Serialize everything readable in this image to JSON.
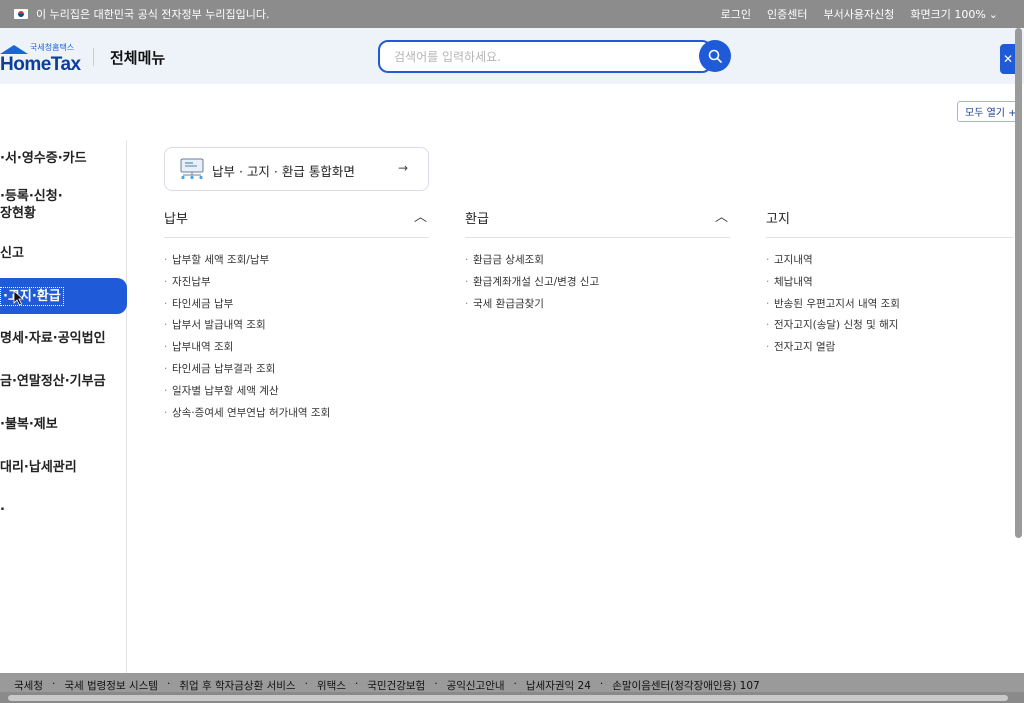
{
  "govbar": {
    "notice": "이 누리집은 대한민국 공식 전자정부 누리집입니다.",
    "links": [
      {
        "label": "로그인"
      },
      {
        "label": "인증센터"
      },
      {
        "label": "부서사용자신청"
      },
      {
        "label": "화면크기 100%"
      }
    ]
  },
  "header": {
    "logo_sub": "국세청홈택스",
    "logo_main": "HomeTax",
    "page_title": "전체메뉴",
    "search_placeholder": "검색어를 입력하세요.",
    "accent": "#1f5bd8"
  },
  "expand_all": "모두 열기 +",
  "sidebar": {
    "items": [
      {
        "label": "·서·영수증·카드",
        "top": 0
      },
      {
        "label": "·등록·신청·",
        "label2": "장현황"
      },
      {
        "label": "신고"
      },
      {
        "label": "·고지·환급",
        "active": true
      },
      {
        "label": "명세·자료·공익법인"
      },
      {
        "label": "금·연말정산·기부금"
      },
      {
        "label": "·불복·제보"
      },
      {
        "label": "대리·납세관리"
      },
      {
        "label": "."
      }
    ]
  },
  "combined_card": {
    "label": "납부 · 고지 · 환급 통합화면",
    "icon": "monitor-network-icon"
  },
  "columns": [
    {
      "title": "납부",
      "items": [
        "납부할 세액 조회/납부",
        "자진납부",
        "타인세금 납부",
        "납부서 발급내역 조회",
        "납부내역 조회",
        "타인세금 납부결과 조회",
        "일자별 납부할 세액 계산",
        "상속·증여세 연부연납 허가내역 조회"
      ]
    },
    {
      "title": "환급",
      "items": [
        "환급금 상세조회",
        "환급계좌개설 신고/변경 신고",
        "국세 환급금찾기"
      ]
    },
    {
      "title": "고지",
      "items": [
        "고지내역",
        "체납내역",
        "반송된 우편고지서 내역 조회",
        "전자고지(송달) 신청 및 해지",
        "전자고지 열람"
      ]
    }
  ],
  "footer": {
    "links": [
      "국세청",
      "국세 법령정보 시스템",
      "취업 후 학자금상환 서비스",
      "위택스",
      "국민건강보험",
      "공익신고안내",
      "납세자권익 24",
      "손말이음센터(청각장애인용) 107"
    ]
  }
}
